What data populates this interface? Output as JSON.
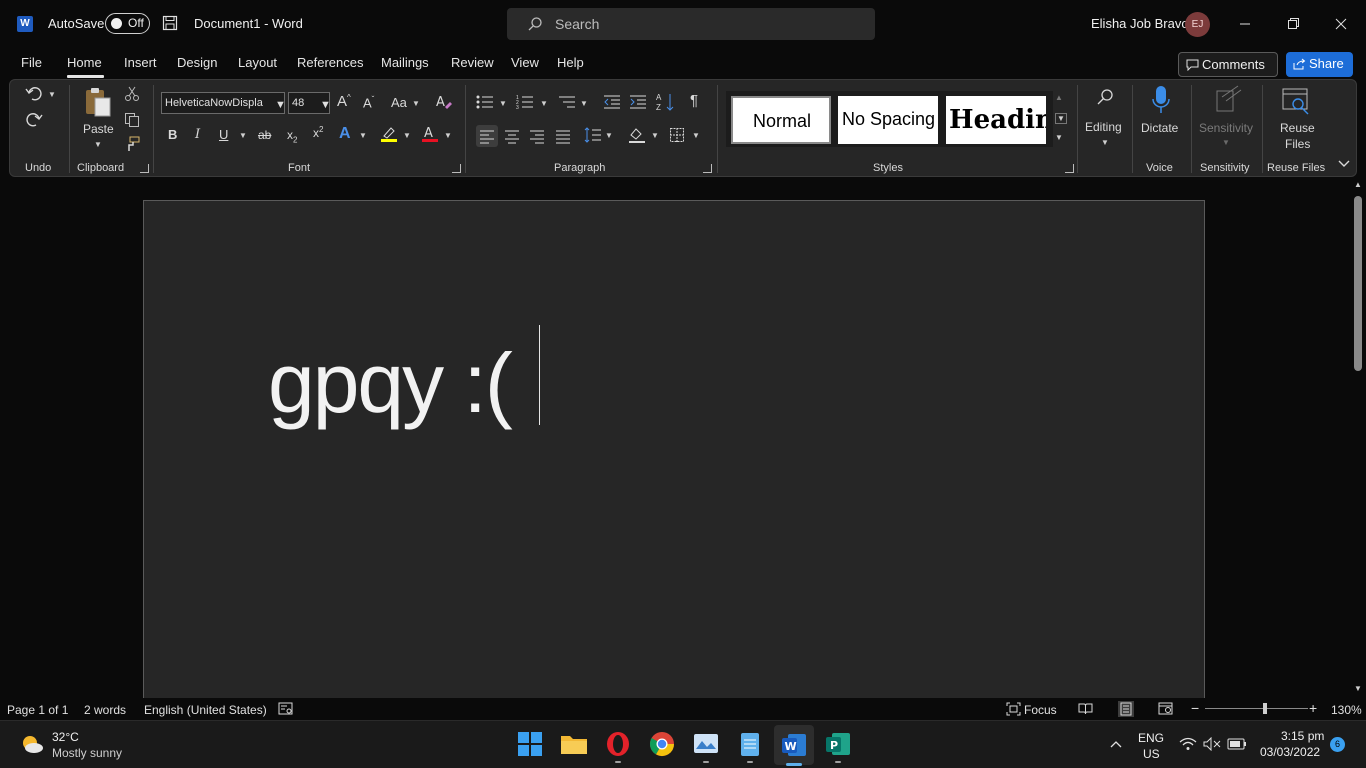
{
  "titlebar": {
    "app_logo_letter": "W",
    "autosave_label": "AutoSave",
    "autosave_state": "Off",
    "document_title": "Document1  -  Word",
    "search_placeholder": "Search",
    "user_name": "Elisha Job Bravo",
    "user_initials": "EJ"
  },
  "tabs": [
    "File",
    "Home",
    "Insert",
    "Design",
    "Layout",
    "References",
    "Mailings",
    "Review",
    "View",
    "Help"
  ],
  "active_tab": "Home",
  "actions": {
    "comments_label": "Comments",
    "share_label": "Share"
  },
  "ribbon": {
    "groups": {
      "undo": "Undo",
      "clipboard": "Clipboard",
      "font": "Font",
      "paragraph": "Paragraph",
      "styles": "Styles",
      "voice": "Voice",
      "sensitivity": "Sensitivity",
      "reuse_files": "Reuse Files"
    },
    "paste_label": "Paste",
    "font_name": "HelveticaNowDispla",
    "font_size": "48",
    "styles": [
      "Normal",
      "No Spacing",
      "Headin"
    ],
    "editing_label": "Editing",
    "dictate_label": "Dictate",
    "sensitivity_label": "Sensitivity",
    "reuse_line1": "Reuse",
    "reuse_line2": "Files"
  },
  "document": {
    "text": "gpqy :("
  },
  "statusbar": {
    "page": "Page 1 of 1",
    "words": "2 words",
    "language": "English (United States)",
    "focus": "Focus",
    "zoom": "130%",
    "zoom_fraction": 0.58
  },
  "taskbar": {
    "weather_temp": "32°C",
    "weather_desc": "Mostly sunny",
    "lang_line1": "ENG",
    "lang_line2": "US",
    "time": "3:15 pm",
    "date": "03/03/2022",
    "notification_count": "6"
  },
  "colors": {
    "accent": "#1d6dd8",
    "word_blue": "#1f5bbf",
    "highlight_yellow": "#ffff00",
    "font_red": "#e81123"
  }
}
